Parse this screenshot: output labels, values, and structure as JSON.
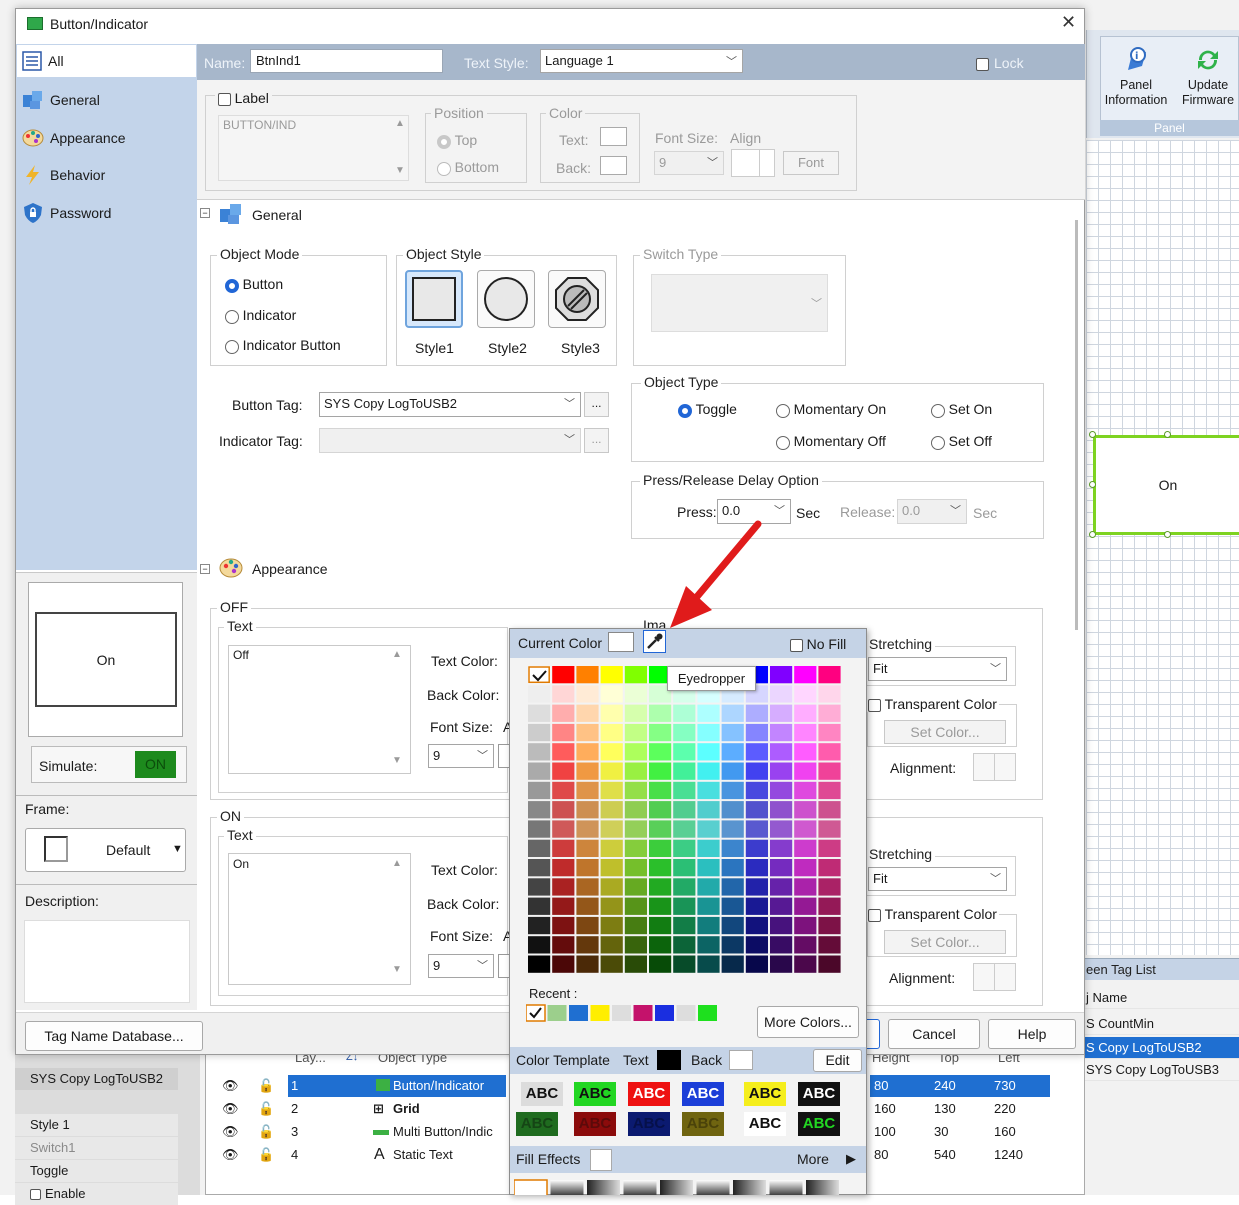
{
  "window": {
    "title": "Button/Indicator",
    "close": "✕"
  },
  "nav": {
    "items": [
      {
        "label": "All"
      },
      {
        "label": "General"
      },
      {
        "label": "Appearance"
      },
      {
        "label": "Behavior"
      },
      {
        "label": "Password"
      }
    ]
  },
  "topbar": {
    "name_label": "Name:",
    "name_value": "BtnInd1",
    "text_style_label": "Text Style:",
    "text_style_value": "Language 1",
    "lock_label": "Lock"
  },
  "label_panel": {
    "label_check": "Label",
    "label_text": "BUTTON/IND",
    "position_title": "Position",
    "pos_top": "Top",
    "pos_bottom": "Bottom",
    "color_title": "Color",
    "text_color": "Text:",
    "back_color": "Back:",
    "font_size_label": "Font Size:",
    "align_label": "Align",
    "font_size_value": "9",
    "font_btn": "Font"
  },
  "general": {
    "header": "General",
    "object_mode_title": "Object Mode",
    "mode_button": "Button",
    "mode_indicator": "Indicator",
    "mode_indicator_button": "Indicator Button",
    "object_style_title": "Object Style",
    "style1": "Style1",
    "style2": "Style2",
    "style3": "Style3",
    "switch_type_title": "Switch Type",
    "button_tag_label": "Button Tag:",
    "button_tag_value": "SYS Copy LogToUSB2",
    "indicator_tag_label": "Indicator Tag:",
    "browse": "...",
    "object_type_title": "Object Type",
    "type_toggle": "Toggle",
    "type_mom_on": "Momentary On",
    "type_set_on": "Set On",
    "type_mom_off": "Momentary Off",
    "type_set_off": "Set Off",
    "delay_title": "Press/Release Delay Option",
    "press_label": "Press:",
    "press_value": "0.0",
    "sec1": "Sec",
    "release_label": "Release:",
    "release_value": "0.0",
    "sec2": "Sec"
  },
  "appearance": {
    "header": "Appearance",
    "off_title": "OFF",
    "on_title": "ON",
    "text_title": "Text",
    "off_text": "Off",
    "on_text": "On",
    "text_color_label": "Text Color:",
    "back_color_label": "Back Color:",
    "font_size_label": "Font Size:",
    "font_size_value": "9",
    "font_size_cut": "A",
    "image_cut": "Ima",
    "stretching_title": "Stretching",
    "stretch_value": "Fit",
    "transparent_label": "Transparent Color",
    "set_color_btn": "Set Color...",
    "alignment_label": "Alignment:"
  },
  "preview": {
    "on_text": "On",
    "simulate_label": "Simulate:",
    "simulate_value": "ON",
    "frame_label": "Frame:",
    "frame_value": "Default",
    "description_label": "Description:"
  },
  "footer": {
    "tag_db_btn": "Tag Name Database...",
    "cancel_btn": "Cancel",
    "help_btn": "Help"
  },
  "color_picker": {
    "current_color_label": "Current Color",
    "eyedropper_tooltip": "Eyedropper",
    "no_fill_label": "No Fill",
    "recent_label": "Recent :",
    "more_colors_btn": "More Colors...",
    "template_label": "Color Template",
    "template_text": "Text",
    "template_back": "Back",
    "edit_btn": "Edit",
    "abc": "ABC",
    "fill_effects_label": "Fill Effects",
    "more_label": "More"
  },
  "ribbon": {
    "panel_info": "Panel Information",
    "update_fw": "Update Firmware",
    "group": "Panel"
  },
  "canvas": {
    "button_text": "On"
  },
  "tag_list": {
    "header": "een Tag List",
    "col": "j Name",
    "rows": [
      "S CountMin",
      "S Copy LogToUSB2",
      "SYS Copy LogToUSB3"
    ]
  },
  "lower_left": {
    "rows": [
      "SYS Copy LogToUSB2",
      "Style 1",
      "Switch1",
      "Toggle",
      "Enable"
    ]
  },
  "table": {
    "headers": [
      "Lay...",
      "Object Type",
      "Height",
      "Top",
      "Left"
    ],
    "rows": [
      {
        "n": "1",
        "type": "Button/Indicator",
        "h": "80",
        "t": "240",
        "l": "730"
      },
      {
        "n": "2",
        "type": "Grid",
        "h": "160",
        "t": "130",
        "l": "220"
      },
      {
        "n": "3",
        "type": "Multi Button/Indic",
        "h": "100",
        "t": "30",
        "l": "160"
      },
      {
        "n": "4",
        "type": "Static Text",
        "h": "80",
        "t": "540",
        "l": "1240"
      }
    ]
  },
  "colors": {
    "accent": "#2166d6",
    "nav_bg": "#c3d4ea",
    "topbar_bg": "#a7b7cb",
    "green": "#1d8a1d",
    "selection": "#1f6fd1",
    "arrow": "#e01b1b"
  }
}
